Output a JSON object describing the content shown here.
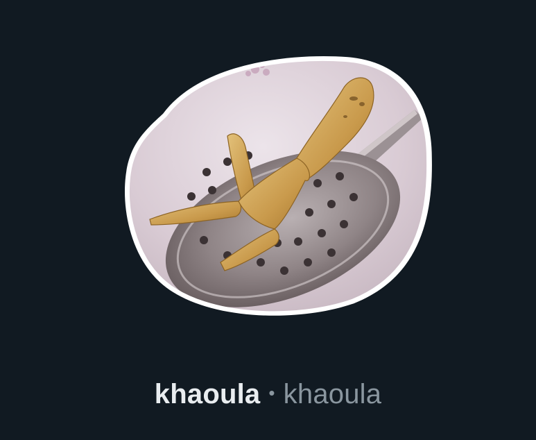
{
  "sticker": {
    "subject": "fried chicken foot on a slotted spoon",
    "outline_color": "#ffffff",
    "background_color": "#111a22"
  },
  "caption": {
    "pack_name": "khaoula",
    "separator": "•",
    "author": "khaoula"
  },
  "colors": {
    "pack_name_text": "#e9edf0",
    "author_text": "#8a969f"
  }
}
